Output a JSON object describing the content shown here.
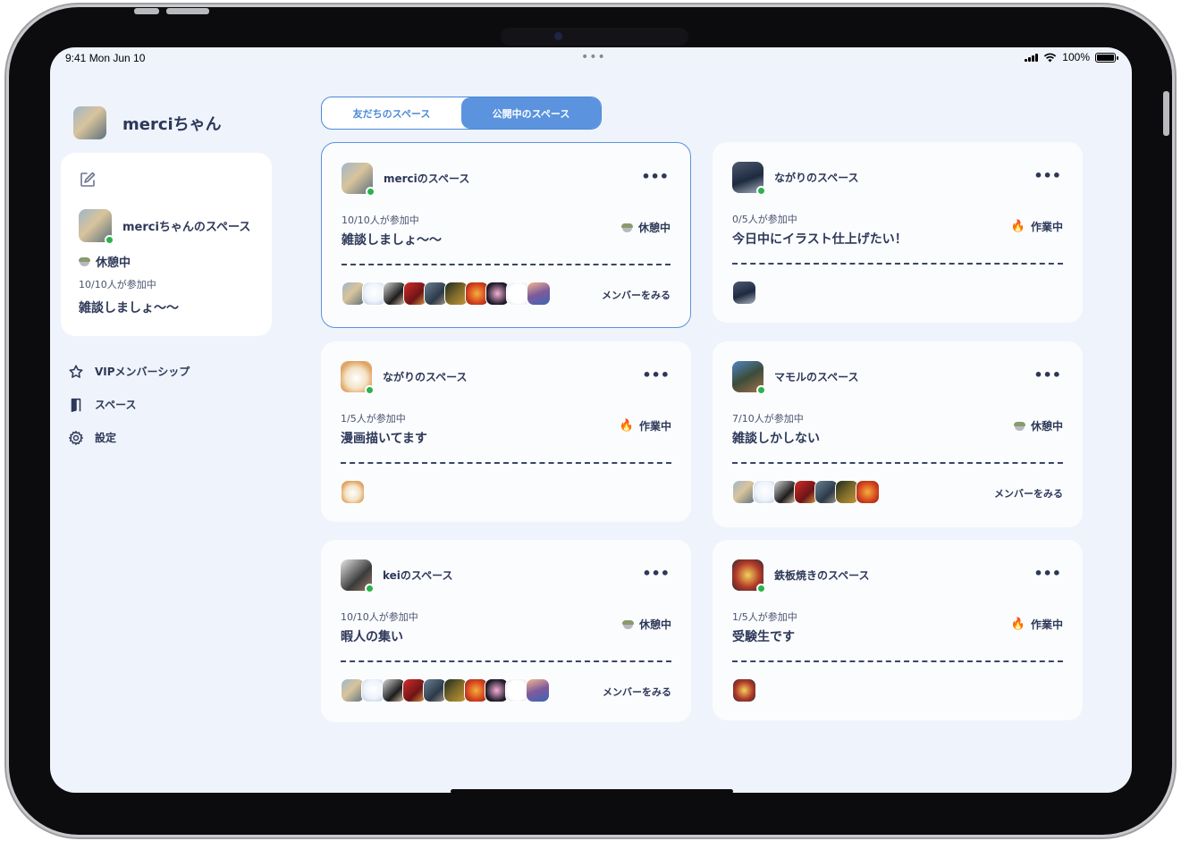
{
  "status_bar": {
    "time": "9:41  Mon Jun 10",
    "battery": "100%"
  },
  "user": {
    "name": "merciちゃん",
    "my_space": {
      "name": "merciちゃんのスペース",
      "status": "休憩中",
      "count": "10/10人が参加中",
      "message": "雑談しましょ〜〜"
    }
  },
  "nav": [
    {
      "label": "VIPメンバーシップ",
      "icon": "star-icon"
    },
    {
      "label": "スペース",
      "icon": "door-icon"
    },
    {
      "label": "設定",
      "icon": "gear-icon"
    }
  ],
  "tabs": [
    {
      "label": "友だちのスペース",
      "active": false
    },
    {
      "label": "公開中のスペース",
      "active": true
    }
  ],
  "cards": [
    {
      "title": "merciのスペース",
      "count": "10/10人が参加中",
      "message": "雑談しましょ〜〜",
      "status": "休憩中",
      "status_icon": "rest",
      "see_members": "メンバーをみる",
      "members": 10,
      "selected": true
    },
    {
      "title": "ながりのスペース",
      "count": "0/5人が参加中",
      "message": "今日中にイラスト仕上げたい！",
      "status": "作業中",
      "status_icon": "fire",
      "see_members": "",
      "members": 1,
      "selected": false
    },
    {
      "title": "ながりのスペース",
      "count": "1/5人が参加中",
      "message": "漫画描いてます",
      "status": "作業中",
      "status_icon": "fire",
      "see_members": "",
      "members": 1,
      "selected": false
    },
    {
      "title": "マモルのスペース",
      "count": "7/10人が参加中",
      "message": "雑談しかしない",
      "status": "休憩中",
      "status_icon": "rest",
      "see_members": "メンバーをみる",
      "members": 7,
      "selected": false
    },
    {
      "title": "keiのスペース",
      "count": "10/10人が参加中",
      "message": "暇人の集い",
      "status": "休憩中",
      "status_icon": "rest",
      "see_members": "メンバーをみる",
      "members": 10,
      "selected": false
    },
    {
      "title": "鉄板焼きのスペース",
      "count": "1/5人が参加中",
      "message": "受験生です",
      "status": "作業中",
      "status_icon": "fire",
      "see_members": "",
      "members": 1,
      "selected": false
    }
  ],
  "more_label": "•••"
}
